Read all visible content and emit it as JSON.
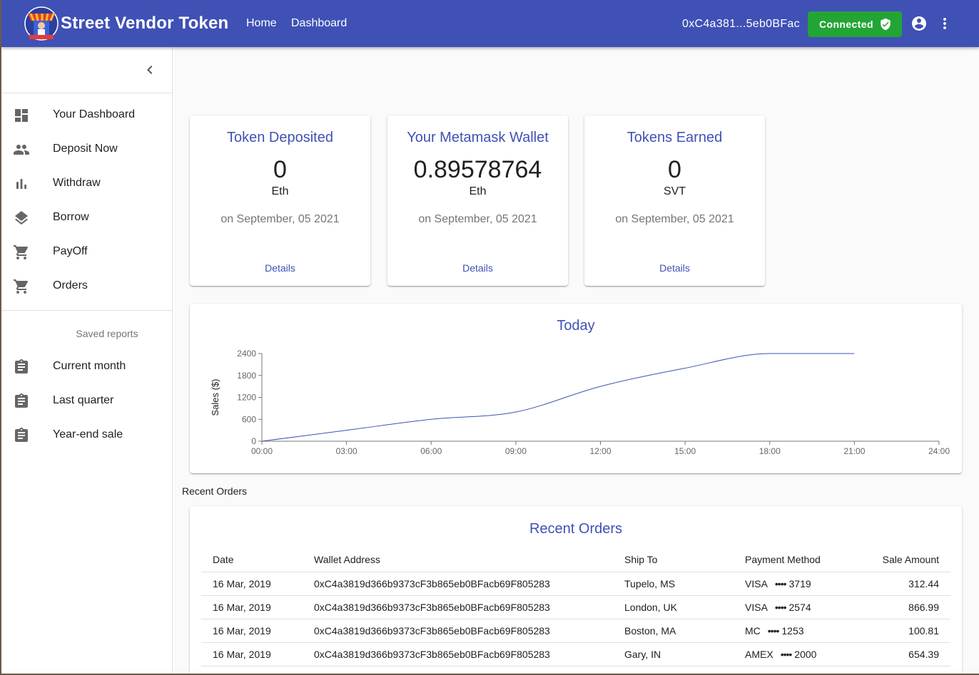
{
  "header": {
    "brand": "Street Vendor Token",
    "nav": [
      "Home",
      "Dashboard"
    ],
    "wallet_address": "0xC4a381...5eb0BFac",
    "connected_label": "Connected"
  },
  "sidebar": {
    "items": [
      {
        "label": "Your Dashboard",
        "icon": "dashboard-icon"
      },
      {
        "label": "Deposit Now",
        "icon": "people-icon"
      },
      {
        "label": "Withdraw",
        "icon": "bar-chart-icon"
      },
      {
        "label": "Borrow",
        "icon": "layers-icon"
      },
      {
        "label": "PayOff",
        "icon": "cart-icon"
      },
      {
        "label": "Orders",
        "icon": "cart-icon"
      }
    ],
    "saved_reports_header": "Saved reports",
    "reports": [
      {
        "label": "Current month",
        "icon": "assignment-icon"
      },
      {
        "label": "Last quarter",
        "icon": "assignment-icon"
      },
      {
        "label": "Year-end sale",
        "icon": "assignment-icon"
      }
    ]
  },
  "cards": [
    {
      "title": "Token Deposited",
      "value": "0",
      "unit": "Eth",
      "date": "on September, 05 2021",
      "link": "Details"
    },
    {
      "title": "Your Metamask Wallet",
      "value": "0.89578764",
      "unit": "Eth",
      "date": "on September, 05 2021",
      "link": "Details"
    },
    {
      "title": "Tokens Earned",
      "value": "0",
      "unit": "SVT",
      "date": "on September, 05 2021",
      "link": "Details"
    }
  ],
  "chart_data": {
    "type": "line",
    "title": "Today",
    "ylabel": "Sales ($)",
    "xlabel": "",
    "x_ticks": [
      "00:00",
      "03:00",
      "06:00",
      "09:00",
      "12:00",
      "15:00",
      "18:00",
      "21:00",
      "24:00"
    ],
    "y_ticks": [
      0,
      600,
      1200,
      1800,
      2400
    ],
    "ylim": [
      0,
      2400
    ],
    "xlim": [
      0,
      24
    ],
    "series": [
      {
        "x": [
          0,
          3,
          6,
          9,
          12,
          15,
          18,
          21
        ],
        "y": [
          0,
          300,
          600,
          800,
          1500,
          2000,
          2400,
          2400
        ]
      }
    ],
    "color": "#3f51b5"
  },
  "orders": {
    "section_label": "Recent Orders",
    "title": "Recent Orders",
    "columns": [
      "Date",
      "Wallet Address",
      "Ship To",
      "Payment Method",
      "Sale Amount"
    ],
    "rows": [
      {
        "date": "16 Mar, 2019",
        "wallet": "0xC4a3819d366b9373cF3b865eb0BFacb69F805283",
        "ship_to": "Tupelo, MS",
        "method": "VISA",
        "last4": "3719",
        "amount": "312.44"
      },
      {
        "date": "16 Mar, 2019",
        "wallet": "0xC4a3819d366b9373cF3b865eb0BFacb69F805283",
        "ship_to": "London, UK",
        "method": "VISA",
        "last4": "2574",
        "amount": "866.99"
      },
      {
        "date": "16 Mar, 2019",
        "wallet": "0xC4a3819d366b9373cF3b865eb0BFacb69F805283",
        "ship_to": "Boston, MA",
        "method": "MC",
        "last4": "1253",
        "amount": "100.81"
      },
      {
        "date": "16 Mar, 2019",
        "wallet": "0xC4a3819d366b9373cF3b865eb0BFacb69F805283",
        "ship_to": "Gary, IN",
        "method": "AMEX",
        "last4": "2000",
        "amount": "654.39"
      }
    ]
  },
  "colors": {
    "primary": "#3f51b5",
    "connected": "#23a536"
  }
}
